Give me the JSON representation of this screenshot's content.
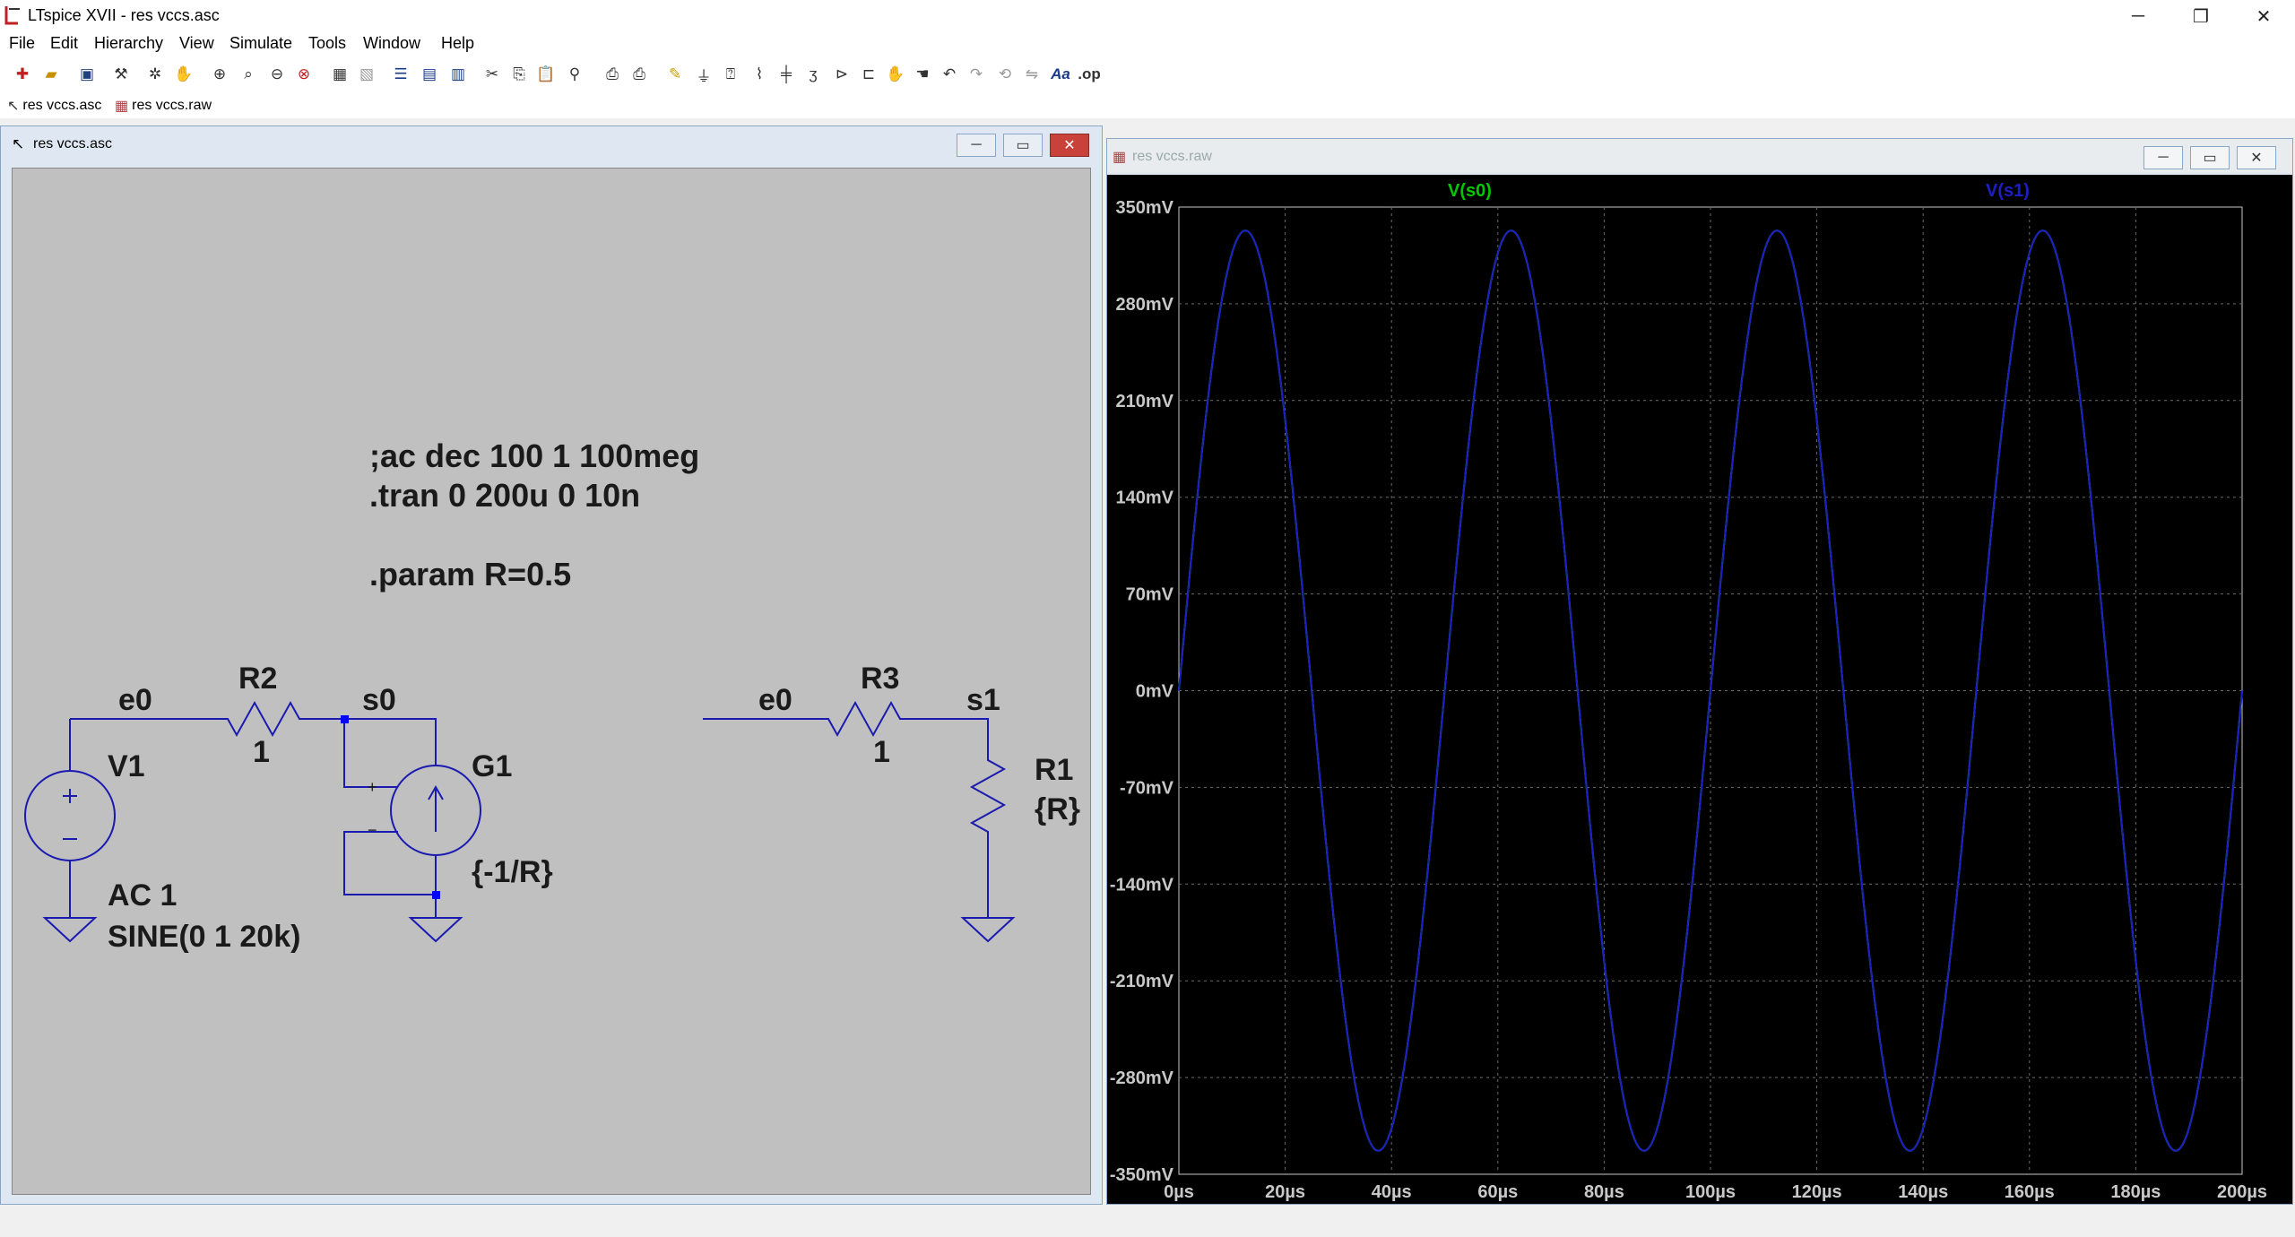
{
  "window": {
    "title": "LTspice XVII - res vccs.asc",
    "minimize": "─",
    "restore": "❐",
    "close": "✕"
  },
  "menu": [
    "File",
    "Edit",
    "Hierarchy",
    "View",
    "Simulate",
    "Tools",
    "Window",
    "Help"
  ],
  "tabs": [
    {
      "label": "res vccs.asc",
      "icon": "schematic-tab-icon"
    },
    {
      "label": "res vccs.raw",
      "icon": "waveform-tab-icon"
    }
  ],
  "schematic_window": {
    "title": "res vccs.asc",
    "directives": [
      ";ac dec 100 1 100meg",
      ".tran 0 200u 0 10n",
      ".param R=0.5"
    ],
    "labels": {
      "e0_left": "e0",
      "r2": "R2",
      "r2_val": "1",
      "s0": "s0",
      "v1": "V1",
      "g1": "G1",
      "g1_val": "{-1/R}",
      "v1_ac": "AC 1",
      "v1_sine": "SINE(0 1 20k)",
      "e0_right": "e0",
      "r3": "R3",
      "r3_val": "1",
      "s1": "s1",
      "r1": "R1",
      "r1_val": "{R}",
      "plus": "+",
      "minus": "−"
    }
  },
  "plot_window": {
    "title": "res vccs.raw"
  },
  "chart_data": {
    "type": "line",
    "title": "",
    "xlabel": "",
    "ylabel": "",
    "x_ticks": [
      "0µs",
      "20µs",
      "40µs",
      "60µs",
      "80µs",
      "100µs",
      "120µs",
      "140µs",
      "160µs",
      "180µs",
      "200µs"
    ],
    "y_ticks": [
      "350mV",
      "280mV",
      "210mV",
      "140mV",
      "70mV",
      "0mV",
      "-70mV",
      "-140mV",
      "-210mV",
      "-280mV",
      "-350mV"
    ],
    "xlim": [
      0,
      200
    ],
    "ylim": [
      -350,
      350
    ],
    "x_unit": "µs",
    "y_unit": "mV",
    "grid": true,
    "background": "#000000",
    "series": [
      {
        "name": "V(s0)",
        "color": "#00c800",
        "amplitude": 333,
        "frequency_khz": 20,
        "phase": "sine"
      },
      {
        "name": "V(s1)",
        "color": "#1e1ec8",
        "amplitude": 333,
        "frequency_khz": 20,
        "phase": "sine"
      }
    ]
  }
}
